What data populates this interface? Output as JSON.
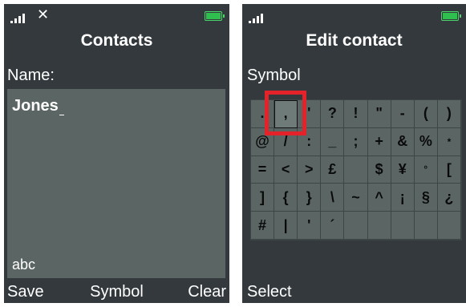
{
  "left_screen": {
    "title": "Contacts",
    "field_label": "Name:",
    "name_value": "Jones",
    "input_mode": "abc",
    "softkeys": {
      "left": "Save",
      "center": "Symbol",
      "right": "Clear"
    }
  },
  "right_screen": {
    "title": "Edit contact",
    "field_label": "Symbol",
    "symbols": [
      [
        ".",
        ",",
        "'",
        "?",
        "!",
        "\"",
        "-",
        "(",
        ")"
      ],
      [
        "@",
        "/",
        ":",
        "_",
        ";",
        "+",
        "&",
        "%",
        "*"
      ],
      [
        "=",
        "<",
        ">",
        "£",
        "",
        "$",
        "¥",
        "°",
        "["
      ],
      [
        "]",
        "{",
        "}",
        "\\",
        "~",
        "^",
        "¡",
        "§",
        "¿"
      ],
      [
        "#",
        "|",
        "'",
        "´",
        "",
        "",
        "",
        "",
        ""
      ]
    ],
    "softkeys": {
      "left": "Select"
    }
  },
  "colors": {
    "background": "#33393d",
    "panel": "#5b6664",
    "battery": "#2fbf4f",
    "highlight": "#e3222a"
  },
  "icons": [
    "signal-icon",
    "close-icon",
    "battery-icon"
  ]
}
